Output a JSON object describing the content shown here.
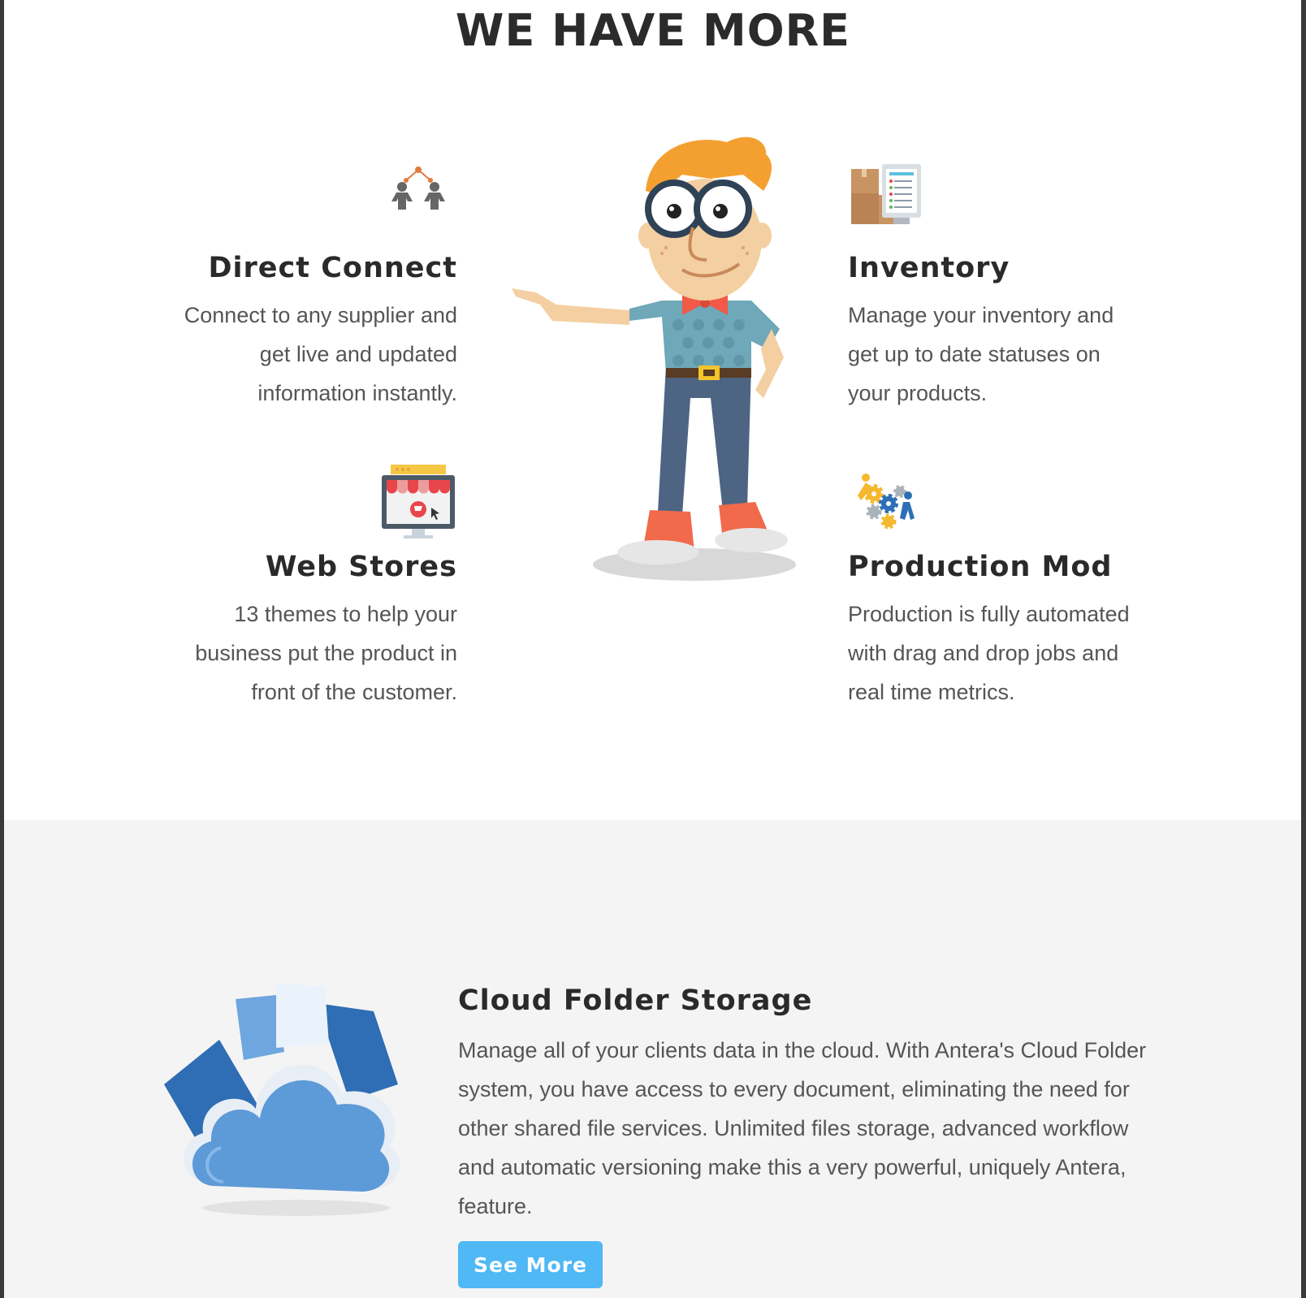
{
  "section": {
    "title": "WE HAVE MORE"
  },
  "features": [
    {
      "title": "Direct Connect",
      "description": "Connect to any supplier and get live and updated information instantly.",
      "icon": "people-network-icon"
    },
    {
      "title": "Web Stores",
      "description": "13 themes to help your business put the product in front of the customer.",
      "icon": "storefront-monitor-icon"
    },
    {
      "title": "Inventory",
      "description": "Manage your inventory and get up to date statuses on your products.",
      "icon": "boxes-checklist-icon"
    },
    {
      "title": "Production Mod",
      "description": "Production is fully automated with drag and drop jobs and real time metrics.",
      "icon": "gears-workers-icon"
    }
  ],
  "cloud": {
    "title": "Cloud Folder Storage",
    "description": "Manage all of your clients data in the cloud. With Antera's Cloud Folder system, you have access to every document, eliminating the need for other shared file services. Unlimited files storage, advanced workflow and automatic versioning make this a very powerful, uniquely Antera, feature.",
    "button_label": "See More",
    "icon": "cloud-folder-icon"
  },
  "colors": {
    "button": "#4fb8f5",
    "lower_background": "#f4f4f4",
    "heading": "#2b2b2b",
    "body_text": "#555555"
  }
}
